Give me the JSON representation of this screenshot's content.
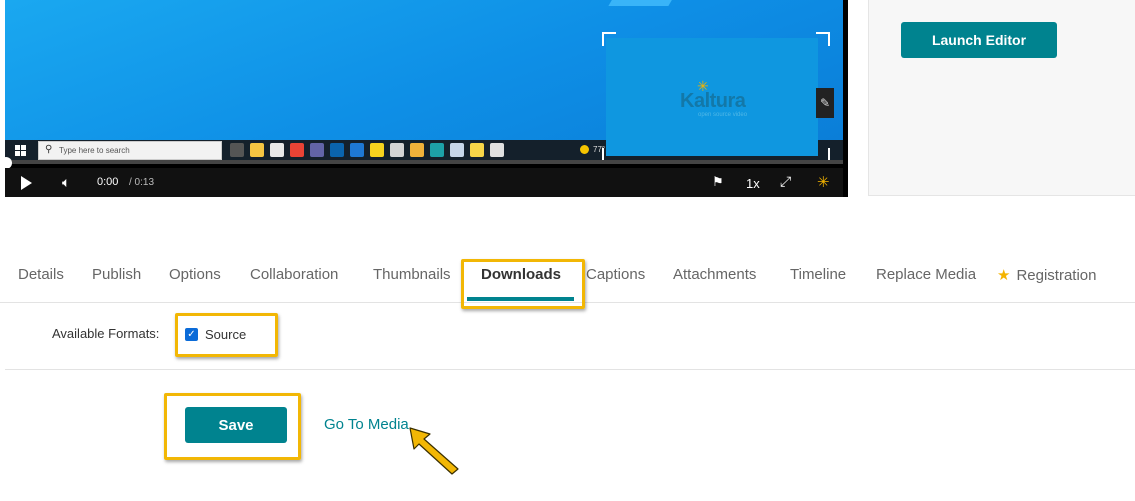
{
  "player": {
    "taskbar_search_placeholder": "Type here to search",
    "taskbar_temp": "77°",
    "pip_logo": "Kaltura",
    "pip_tagline": "open source video",
    "current_time": "0:00",
    "duration": "/ 0:13",
    "speed": "1x",
    "progress": 0
  },
  "side_panel": {
    "launch_editor_label": "Launch Editor"
  },
  "tabs": [
    {
      "label": "Details"
    },
    {
      "label": "Publish"
    },
    {
      "label": "Options"
    },
    {
      "label": "Collaboration"
    },
    {
      "label": "Thumbnails"
    },
    {
      "label": "Downloads",
      "active": true
    },
    {
      "label": "Captions"
    },
    {
      "label": "Attachments"
    },
    {
      "label": "Timeline"
    },
    {
      "label": "Replace Media"
    },
    {
      "label": "Registration",
      "icon": "star-icon"
    }
  ],
  "form": {
    "available_formats_label": "Available Formats:",
    "source_label": "Source",
    "source_checked": true,
    "save_label": "Save",
    "go_to_media_label": "Go To Media"
  },
  "colors": {
    "accent": "#00838f",
    "highlight": "#f2b705",
    "checkbox": "#0b6bd8"
  }
}
